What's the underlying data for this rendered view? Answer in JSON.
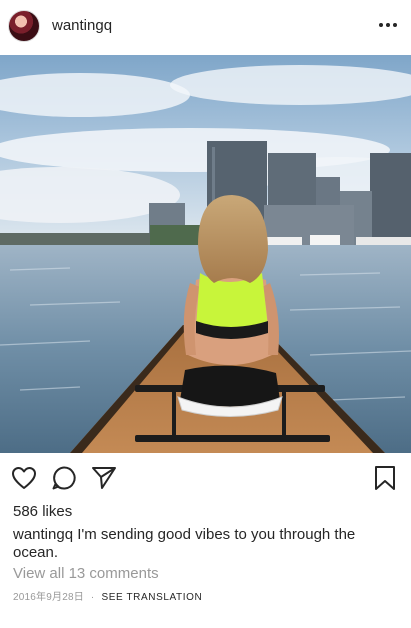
{
  "post": {
    "username": "wantingq",
    "avatar_icon": "profile-avatar",
    "more_icon": "more-horizontal-icon",
    "likes": "586 likes",
    "caption_text": "I'm sending good vibes to you through the ocean.",
    "view_comments": "View all 13 comments",
    "date": "2016年9月28日",
    "separator": "·",
    "see_translation": "SEE TRANSLATION"
  },
  "actions": {
    "like_icon": "heart-icon",
    "comment_icon": "comment-icon",
    "share_icon": "send-icon",
    "save_icon": "bookmark-icon"
  },
  "colors": {
    "text": "#262626",
    "muted": "#999999",
    "neon_top": "#c8f53a",
    "water": "#6f8ea6"
  }
}
